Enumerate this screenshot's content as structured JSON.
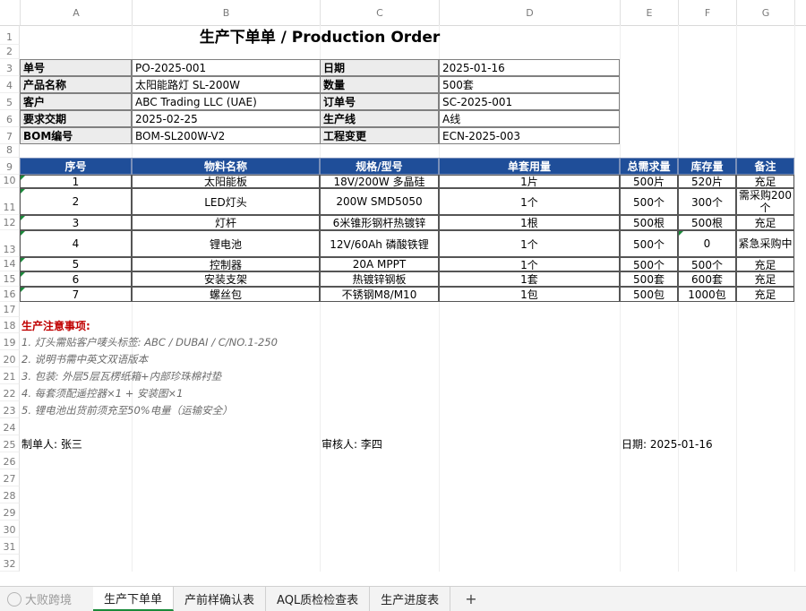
{
  "columns": [
    "A",
    "B",
    "C",
    "D",
    "E",
    "F",
    "G"
  ],
  "title": "生产下单单 / Production Order",
  "info": [
    {
      "l1": "单号",
      "v1": "PO-2025-001",
      "l2": "日期",
      "v2": "2025-01-16"
    },
    {
      "l1": "产品名称",
      "v1": "太阳能路灯 SL-200W",
      "l2": "数量",
      "v2": "500套"
    },
    {
      "l1": "客户",
      "v1": "ABC Trading LLC (UAE)",
      "l2": "订单号",
      "v2": "SC-2025-001"
    },
    {
      "l1": "要求交期",
      "v1": "2025-02-25",
      "l2": "生产线",
      "v2": "A线"
    },
    {
      "l1": "BOM编号",
      "v1": "BOM-SL200W-V2",
      "l2": "工程变更",
      "v2": "ECN-2025-003"
    }
  ],
  "table_headers": [
    "序号",
    "物料名称",
    "规格/型号",
    "单套用量",
    "总需求量",
    "库存量",
    "备注"
  ],
  "table_rows": [
    {
      "no": "1",
      "name": "太阳能板",
      "spec": "18V/200W 多晶硅",
      "unit": "1片",
      "total": "500片",
      "stock": "520片",
      "note": "充足"
    },
    {
      "no": "2",
      "name": "LED灯头",
      "spec": "200W SMD5050",
      "unit": "1个",
      "total": "500个",
      "stock": "300个",
      "note": "需采购200个"
    },
    {
      "no": "3",
      "name": "灯杆",
      "spec": "6米锥形钢杆热镀锌",
      "unit": "1根",
      "total": "500根",
      "stock": "500根",
      "note": "充足"
    },
    {
      "no": "4",
      "name": "锂电池",
      "spec": "12V/60Ah 磷酸铁锂",
      "unit": "1个",
      "total": "500个",
      "stock": "0",
      "note": "紧急采购中"
    },
    {
      "no": "5",
      "name": "控制器",
      "spec": "20A MPPT",
      "unit": "1个",
      "total": "500个",
      "stock": "500个",
      "note": "充足"
    },
    {
      "no": "6",
      "name": "安装支架",
      "spec": "热镀锌钢板",
      "unit": "1套",
      "total": "500套",
      "stock": "600套",
      "note": "充足"
    },
    {
      "no": "7",
      "name": "螺丝包",
      "spec": "不锈钢M8/M10",
      "unit": "1包",
      "total": "500包",
      "stock": "1000包",
      "note": "充足"
    }
  ],
  "notes_title": "生产注意事项:",
  "notes": [
    "1. 灯头需贴客户唛头标签: ABC / DUBAI / C/NO.1-250",
    "2. 说明书需中英文双语版本",
    "3. 包装: 外层5层瓦楞纸箱+内部珍珠棉衬垫",
    "4. 每套须配遥控器×1 + 安装图×1",
    "5. 锂电池出货前须充至50%电量（运输安全）"
  ],
  "signatures": {
    "maker": "制单人: 张三",
    "reviewer": "审核人: 李四",
    "date": "日期: 2025-01-16"
  },
  "watermark": "大败跨境",
  "sheet_tabs": [
    "生产下单单",
    "产前样确认表",
    "AQL质检检查表",
    "生产进度表"
  ],
  "add_tab": "+"
}
